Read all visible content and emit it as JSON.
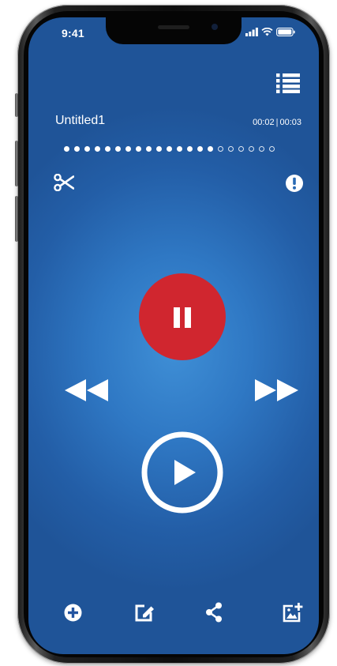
{
  "status_bar": {
    "time": "9:41",
    "icons": [
      "signal-bars-icon",
      "wifi-icon",
      "battery-icon"
    ]
  },
  "toolbar_top": {
    "menu_icon": "list-menu-icon"
  },
  "recording": {
    "title": "Untitled1",
    "elapsed": "00:02",
    "separator": "|",
    "total": "00:03",
    "progress_dots_total": 21,
    "progress_dots_filled": 15
  },
  "edit_tools": {
    "cut_icon": "scissors-icon",
    "info_icon": "exclamation-icon"
  },
  "controls": {
    "pause_icon": "pause-icon",
    "rewind_icon": "rewind-icon",
    "forward_icon": "fast-forward-icon",
    "play_icon": "play-icon"
  },
  "bottom_bar": {
    "items": [
      "add-icon",
      "edit-icon",
      "share-icon",
      "add-image-icon"
    ]
  },
  "colors": {
    "screen_background": "#2b6db8",
    "pause_button": "#d0262f",
    "foreground": "#ffffff"
  }
}
